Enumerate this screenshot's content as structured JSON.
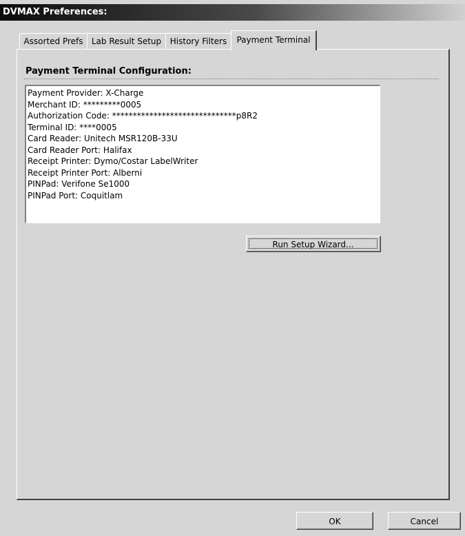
{
  "window": {
    "title": "DVMAX Preferences:"
  },
  "tabs": [
    {
      "label": "Assorted Prefs"
    },
    {
      "label": "Lab Result Setup"
    },
    {
      "label": "History Filters"
    },
    {
      "label": "Payment Terminal",
      "active": true
    }
  ],
  "payment_terminal": {
    "section_title": "Payment Terminal Configuration:",
    "config_lines": [
      "Payment Provider: X-Charge",
      "Merchant ID: *********0005",
      "Authorization Code: ******************************p8R2",
      "Terminal ID: ****0005",
      "Card Reader: Unitech MSR120B-33U",
      "Card Reader Port: Halifax",
      "Receipt Printer: Dymo/Costar LabelWriter",
      "Receipt Printer Port: Alberni",
      "PINPad: Verifone Se1000",
      "PINPad Port: Coquitlam"
    ],
    "wizard_button_label": "Run Setup Wizard..."
  },
  "footer": {
    "ok_label": "OK",
    "cancel_label": "Cancel"
  }
}
